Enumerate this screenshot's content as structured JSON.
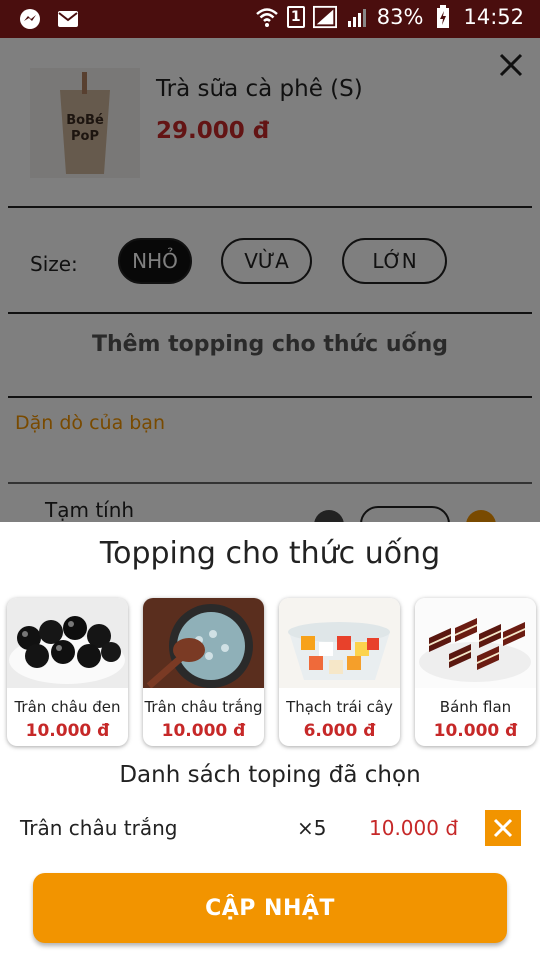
{
  "status_bar": {
    "battery": "83%",
    "time": "14:52",
    "sim": "1",
    "left_icons": [
      "messenger-icon",
      "mail-icon"
    ],
    "right_icons": [
      "wifi-icon",
      "sim-icon",
      "signal-icon",
      "signal-icon",
      "battery-icon"
    ]
  },
  "product": {
    "name": "Trà sữa cà phê (S)",
    "price": "29.000 đ",
    "image_icon": "milk-tea-cup",
    "cup_text": [
      "BoBé",
      "PoP"
    ]
  },
  "size": {
    "label": "Size:",
    "options": [
      "NHỎ",
      "VỪA",
      "LỚN"
    ],
    "selected": "NHỎ"
  },
  "add_topping_label": "Thêm topping cho thức uống",
  "note_placeholder": "Dặn dò của bạn",
  "subtotal_label": "Tạm tính",
  "colors": {
    "accent": "#f29400",
    "price": "#c62828",
    "status_bar": "#4a0e0e"
  },
  "topping_sheet": {
    "title": "Topping cho thức uống",
    "items": [
      {
        "name": "Trân châu đen",
        "price": "10.000 đ"
      },
      {
        "name": "Trân châu trắng",
        "price": "10.000 đ"
      },
      {
        "name": "Thạch trái cây",
        "price": "6.000 đ"
      },
      {
        "name": "Bánh flan",
        "price": "10.000 đ"
      }
    ],
    "selected_title": "Danh sách toping đã chọn",
    "selected": [
      {
        "name": "Trân châu trắng",
        "qty": "×5",
        "price": "10.000 đ"
      }
    ],
    "update_label": "CẬP NHẬT"
  }
}
